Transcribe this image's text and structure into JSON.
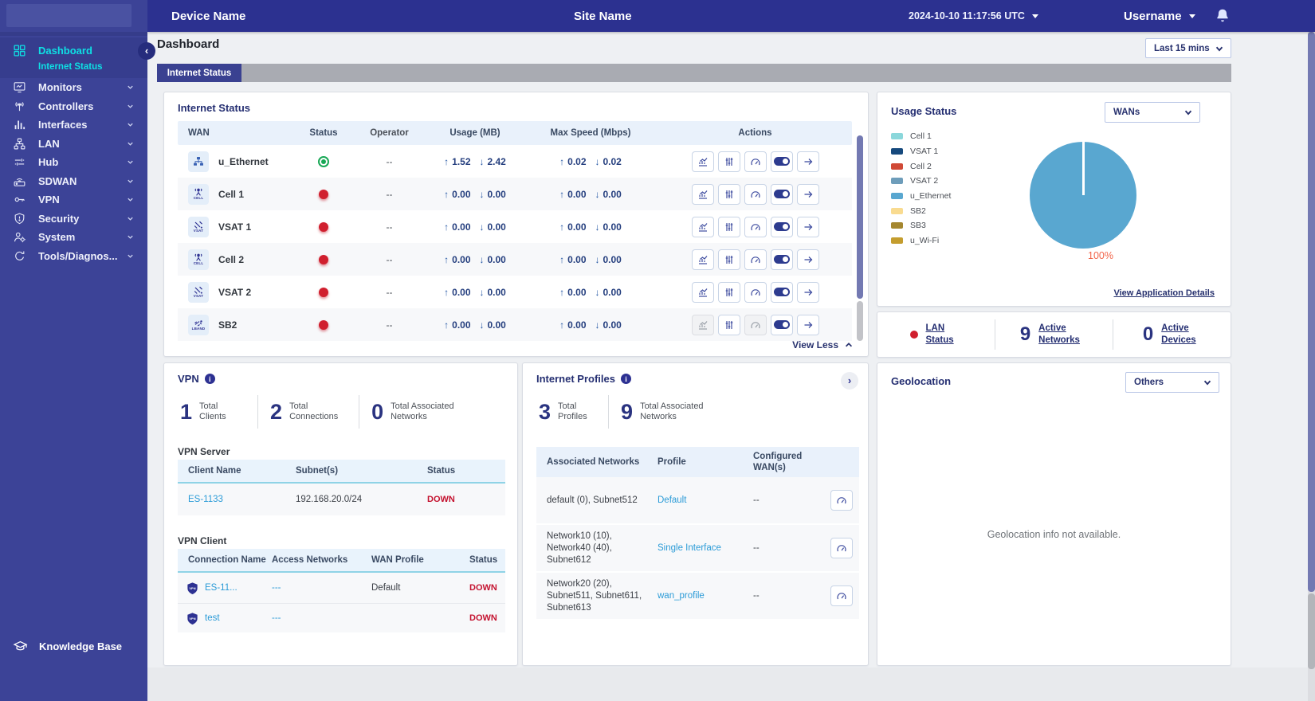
{
  "header": {
    "device_name": "Device Name",
    "site_name": "Site Name",
    "timestamp": "2024-10-10 11:17:56 UTC",
    "username": "Username"
  },
  "icons": {
    "up_arrow": "↑",
    "down_arrow": "↓",
    "collapse": "‹",
    "expand": "›",
    "info": "i"
  },
  "colors": {
    "accent_cyan": "#0ee0e4",
    "link_blue": "#2b9bd7",
    "down_red": "#c4122f",
    "sidebar": "#3c4397",
    "topbar": "#2c3190"
  },
  "sidebar": {
    "items": [
      {
        "label": "Dashboard"
      },
      {
        "label": "Monitors"
      },
      {
        "label": "Controllers"
      },
      {
        "label": "Interfaces"
      },
      {
        "label": "LAN"
      },
      {
        "label": "Hub"
      },
      {
        "label": "SDWAN"
      },
      {
        "label": "VPN"
      },
      {
        "label": "Security"
      },
      {
        "label": "System"
      },
      {
        "label": "Tools/Diagnos..."
      }
    ],
    "dashboard_subitem": "Internet Status",
    "footer_label": "Knowledge Base"
  },
  "page": {
    "title": "Dashboard",
    "time_filter": "Last 15 mins",
    "active_tab": "Internet Status"
  },
  "internet_status": {
    "title": "Internet Status",
    "columns": [
      "WAN",
      "Status",
      "Operator",
      "Usage (MB)",
      "Max Speed (Mbps)",
      "Actions"
    ],
    "status_colors": {
      "up": "#19a856",
      "down": "#d01f2e"
    },
    "rows": [
      {
        "name": "u_Ethernet",
        "badge": "",
        "status": "up",
        "operator": "--",
        "usage_up": "1.52",
        "usage_down": "2.42",
        "speed_up": "0.02",
        "speed_down": "0.02"
      },
      {
        "name": "Cell 1",
        "badge": "CELL",
        "status": "down",
        "operator": "--",
        "usage_up": "0.00",
        "usage_down": "0.00",
        "speed_up": "0.00",
        "speed_down": "0.00"
      },
      {
        "name": "VSAT 1",
        "badge": "VSAT",
        "status": "down",
        "operator": "--",
        "usage_up": "0.00",
        "usage_down": "0.00",
        "speed_up": "0.00",
        "speed_down": "0.00"
      },
      {
        "name": "Cell 2",
        "badge": "CELL",
        "status": "down",
        "operator": "--",
        "usage_up": "0.00",
        "usage_down": "0.00",
        "speed_up": "0.00",
        "speed_down": "0.00"
      },
      {
        "name": "VSAT 2",
        "badge": "VSAT",
        "status": "down",
        "operator": "--",
        "usage_up": "0.00",
        "usage_down": "0.00",
        "speed_up": "0.00",
        "speed_down": "0.00"
      },
      {
        "name": "SB2",
        "badge": "LBAND",
        "status": "down",
        "operator": "--",
        "usage_up": "0.00",
        "usage_down": "0.00",
        "speed_up": "0.00",
        "speed_down": "0.00"
      }
    ],
    "view_less": "View Less"
  },
  "usage_status": {
    "title": "Usage Status",
    "filter": "WANs",
    "legend": [
      {
        "label": "Cell 1",
        "color": "#8bd7db"
      },
      {
        "label": "VSAT 1",
        "color": "#16497d"
      },
      {
        "label": "Cell 2",
        "color": "#d04936"
      },
      {
        "label": "VSAT 2",
        "color": "#6e9dba"
      },
      {
        "label": "u_Ethernet",
        "color": "#59a7d0"
      },
      {
        "label": "SB2",
        "color": "#f9db90"
      },
      {
        "label": "SB3",
        "color": "#a5872f"
      },
      {
        "label": "u_Wi-Fi",
        "color": "#c49d2e"
      }
    ],
    "pie_color": "#59a7d0",
    "pie_label": "100%",
    "pie_label_color": "#f2654a",
    "link": "View Application Details"
  },
  "chart_data": {
    "type": "pie",
    "title": "Usage Status (WANs)",
    "labels": [
      "Cell 1",
      "VSAT 1",
      "Cell 2",
      "VSAT 2",
      "u_Ethernet",
      "SB2",
      "SB3",
      "u_Wi-Fi"
    ],
    "values": [
      0,
      0,
      0,
      0,
      100,
      0,
      0,
      0
    ],
    "unit": "%",
    "annotations": [
      "100%"
    ],
    "legend_position": "left"
  },
  "lan_status": {
    "status_label": "LAN Status",
    "indicator_color": "#d01f2e",
    "networks_value": "9",
    "networks_label": "Active Networks",
    "devices_value": "0",
    "devices_label": "Active Devices"
  },
  "vpn": {
    "title": "VPN",
    "stats": [
      {
        "value": "1",
        "label": "Total Clients"
      },
      {
        "value": "2",
        "label": "Total Connections"
      },
      {
        "value": "0",
        "label": "Total Associated Networks"
      }
    ],
    "server": {
      "title": "VPN Server",
      "columns": [
        "Client Name",
        "Subnet(s)",
        "Status"
      ],
      "rows": [
        {
          "client": "ES-1133",
          "subnet": "192.168.20.0/24",
          "status": "DOWN"
        }
      ]
    },
    "client": {
      "title": "VPN Client",
      "columns": [
        "Connection Name",
        "Access Networks",
        "WAN Profile",
        "Status"
      ],
      "rows": [
        {
          "name": "ES-11...",
          "access": "---",
          "profile": "Default",
          "status": "DOWN"
        },
        {
          "name": "test",
          "access": "---",
          "profile": "",
          "status": "DOWN"
        }
      ]
    }
  },
  "internet_profiles": {
    "title": "Internet Profiles",
    "stats": [
      {
        "value": "3",
        "label": "Total Profiles"
      },
      {
        "value": "9",
        "label": "Total Associated Networks"
      }
    ],
    "columns": [
      "Associated Networks",
      "Profile",
      "Configured WAN(s)"
    ],
    "rows": [
      {
        "networks": "default (0), Subnet512",
        "profile": "Default",
        "wans": "--"
      },
      {
        "networks": "Network10 (10), Network40 (40), Subnet612",
        "profile": "Single Interface",
        "wans": "--"
      },
      {
        "networks": "Network20 (20), Subnet511, Subnet611, Subnet613",
        "profile": "wan_profile",
        "wans": "--"
      }
    ]
  },
  "geolocation": {
    "title": "Geolocation",
    "filter": "Others",
    "message": "Geolocation info not available."
  }
}
